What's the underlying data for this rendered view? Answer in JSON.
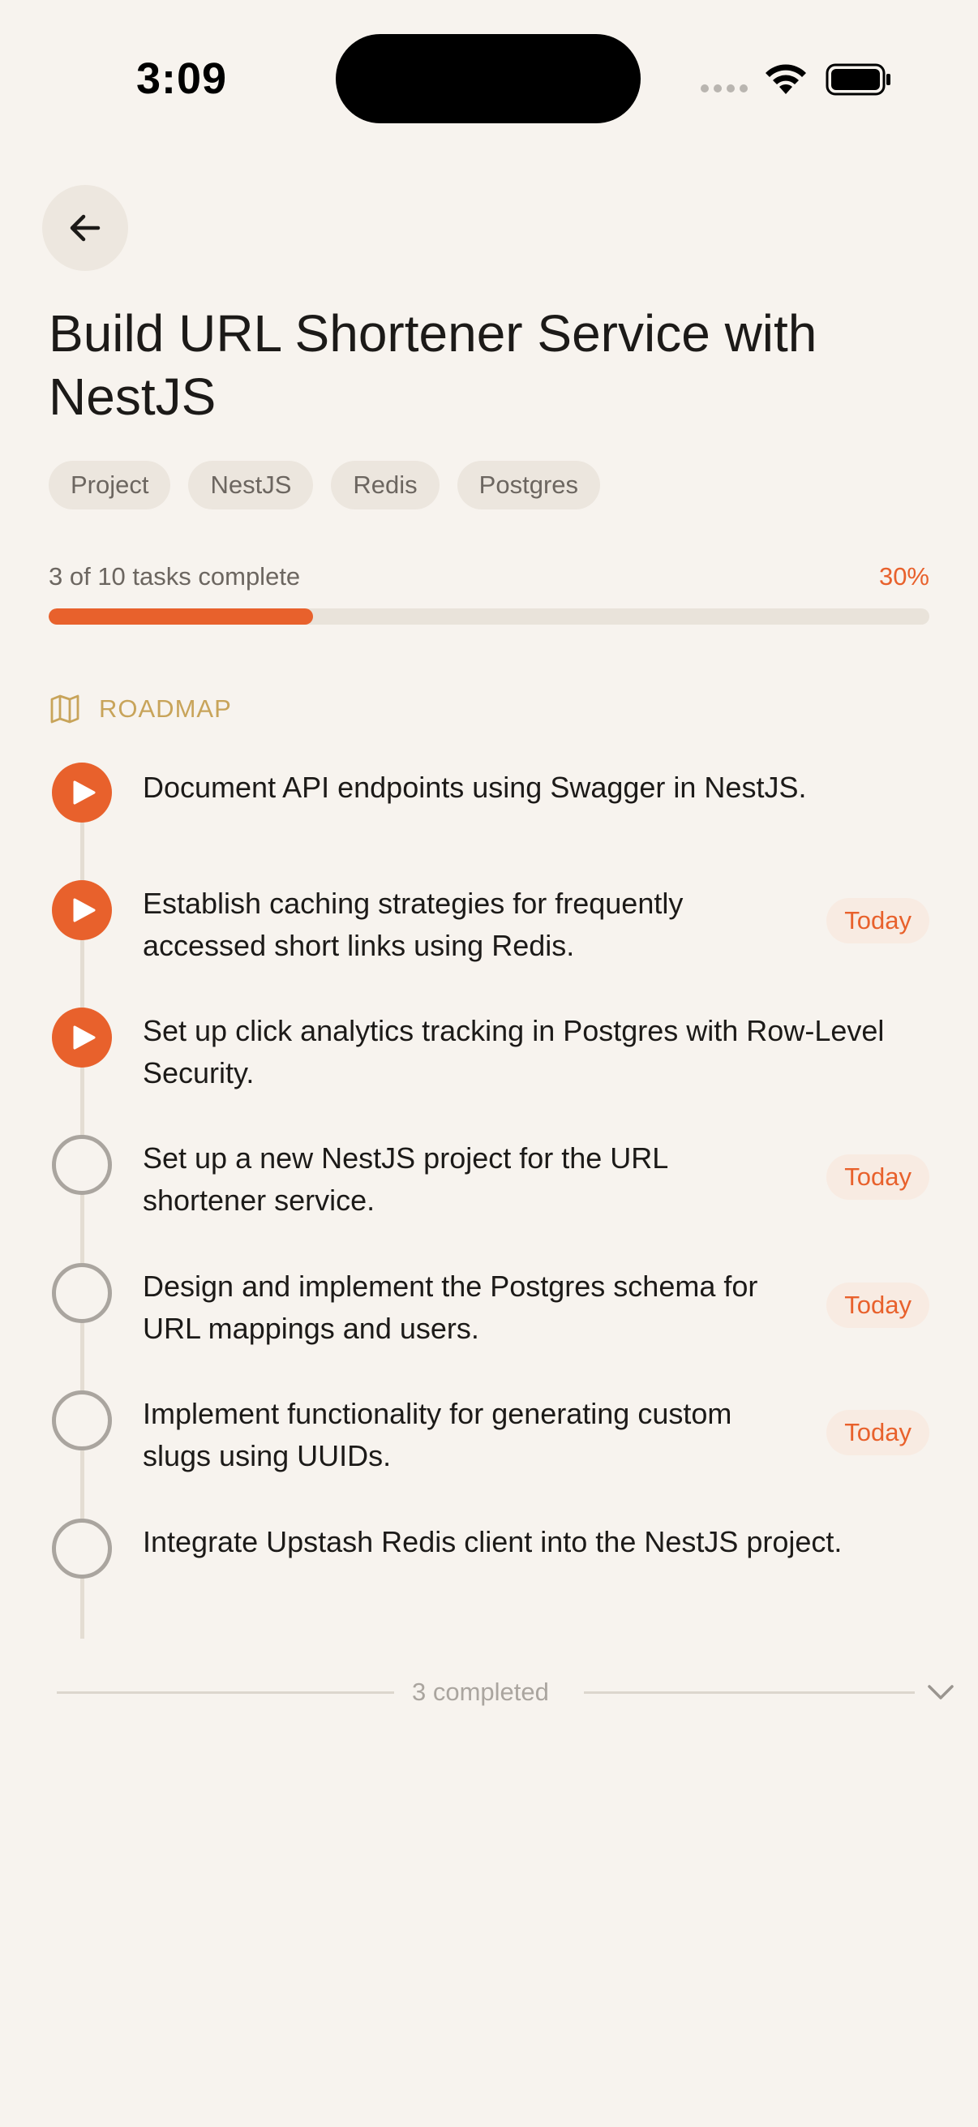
{
  "status_bar": {
    "time": "3:09",
    "icons": [
      "signal-icon",
      "wifi-icon",
      "battery-icon"
    ]
  },
  "header": {
    "back_icon": "arrow-left-icon"
  },
  "title": "Build URL Shortener Service with NestJS",
  "tags": [
    "Project",
    "NestJS",
    "Redis",
    "Postgres"
  ],
  "progress": {
    "label": "3 of 10 tasks complete",
    "percent_label": "30%",
    "fraction": 0.3,
    "accent_color": "#e8612c"
  },
  "roadmap": {
    "label": "ROADMAP",
    "icon": "map-icon",
    "tasks": [
      {
        "text": "Document API endpoints using Swagger in NestJS.",
        "status": "in-progress",
        "due": ""
      },
      {
        "text": "Establish caching strategies for frequently accessed short links using Redis.",
        "status": "in-progress",
        "due": "Today"
      },
      {
        "text": "Set up click analytics tracking in Postgres with Row-Level Security.",
        "status": "in-progress",
        "due": ""
      },
      {
        "text": "Set up a new NestJS project for the URL shortener service.",
        "status": "pending",
        "due": "Today"
      },
      {
        "text": "Design and implement the Postgres schema for URL mappings and users.",
        "status": "pending",
        "due": "Today"
      },
      {
        "text": "Implement functionality for generating custom slugs using UUIDs.",
        "status": "pending",
        "due": "Today"
      },
      {
        "text": "Integrate Upstash Redis client into the NestJS project.",
        "status": "pending",
        "due": ""
      }
    ]
  },
  "completed": {
    "label": "3 completed",
    "icon": "chevron-down-icon"
  }
}
